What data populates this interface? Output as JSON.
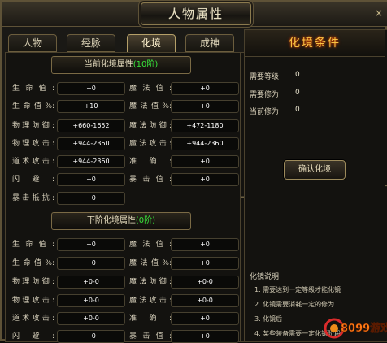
{
  "window": {
    "title": "人物属性",
    "close": "×"
  },
  "tabs": [
    "人物",
    "经脉",
    "化境",
    "成神"
  ],
  "active_tab": 2,
  "current": {
    "banner": "当前化境属性",
    "level": "(10阶)",
    "rows": [
      {
        "l1": "生命值:",
        "v1": "+0",
        "l2": "魔法值:",
        "v2": "+0"
      },
      {
        "l1": "生命值%:",
        "v1": "+10",
        "l2": "魔法值%:",
        "v2": "+0"
      },
      {
        "l1": "物理防御:",
        "v1": "+660-1652",
        "l2": "魔法防御:",
        "v2": "+472-1180"
      },
      {
        "l1": "物理攻击:",
        "v1": "+944-2360",
        "l2": "魔法攻击:",
        "v2": "+944-2360"
      },
      {
        "l1": "道术攻击:",
        "v1": "+944-2360",
        "l2": "准确:",
        "v2": "+0"
      },
      {
        "l1": "闪避:",
        "v1": "+0",
        "l2": "暴击值:",
        "v2": "+0"
      },
      {
        "l1": "暴击抵抗:",
        "v1": "+0"
      }
    ]
  },
  "next": {
    "banner": "下阶化境属性",
    "level": "(0阶)",
    "rows": [
      {
        "l1": "生命值:",
        "v1": "+0",
        "l2": "魔法值:",
        "v2": "+0"
      },
      {
        "l1": "生命值%:",
        "v1": "+0",
        "l2": "魔法值%:",
        "v2": "+0"
      },
      {
        "l1": "物理防御:",
        "v1": "+0-0",
        "l2": "魔法防御:",
        "v2": "+0-0"
      },
      {
        "l1": "物理攻击:",
        "v1": "+0-0",
        "l2": "魔法攻击:",
        "v2": "+0-0"
      },
      {
        "l1": "道术攻击:",
        "v1": "+0-0",
        "l2": "准确:",
        "v2": "+0"
      },
      {
        "l1": "闪避:",
        "v1": "+0",
        "l2": "暴击值:",
        "v2": "+0"
      }
    ]
  },
  "conditions": {
    "title": "化境条件",
    "items": [
      {
        "label": "需要等级:",
        "value": "0"
      },
      {
        "label": "需要修为:",
        "value": "0"
      },
      {
        "label": "当前修为:",
        "value": "0"
      }
    ],
    "confirm": "确认化境",
    "desc_title": "化镜说明:",
    "desc_lines": [
      "1. 需要达到一定等级才能化镜",
      "2. 化镜需要消耗一定的修为",
      "3. 化镜后",
      "4. 某些装备需要一定化镜阶段"
    ]
  },
  "watermark": {
    "text": "8099游戏"
  },
  "colors": {
    "accent_green": "#37e23a",
    "title_gold": "#f6c343",
    "border": "#5e5237"
  }
}
